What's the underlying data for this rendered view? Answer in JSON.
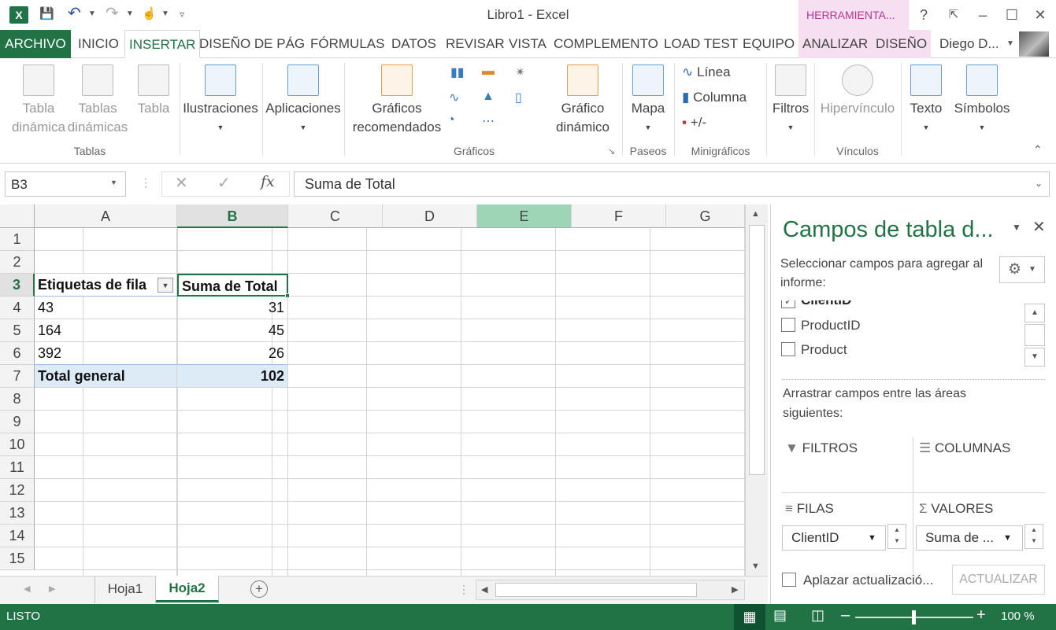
{
  "window": {
    "title": "Libro1 - Excel",
    "contextual_tab_group": "HERRAMIENTA...",
    "help": "?",
    "user": "Diego D..."
  },
  "tabs": [
    "ARCHIVO",
    "INICIO",
    "INSERTAR",
    "DISEÑO DE PÁG",
    "FÓRMULAS",
    "DATOS",
    "REVISAR",
    "VISTA",
    "COMPLEMENTO",
    "LOAD TEST",
    "EQUIPO",
    "ANALIZAR",
    "DISEÑO"
  ],
  "ribbon": {
    "tablas": {
      "btn1_l1": "Tabla",
      "btn1_l2": "dinámica",
      "btn2_l1": "Tablas",
      "btn2_l2": "dinámicas",
      "btn3": "Tabla",
      "label": "Tablas"
    },
    "ilustraciones": "Ilustraciones",
    "aplicaciones": "Aplicaciones",
    "graficos": {
      "rec_l1": "Gráficos",
      "rec_l2": "recomendados",
      "label": "Gráficos",
      "din_l1": "Gráfico",
      "din_l2": "dinámico"
    },
    "paseos": {
      "mapa": "Mapa",
      "label": "Paseos"
    },
    "minigraficos": {
      "linea": "Línea",
      "columna": "Columna",
      "ganancia": "+/-",
      "label": "Minigráficos"
    },
    "filtros": "Filtros",
    "vinculos": {
      "hipervinculo": "Hipervínculo",
      "label": "Vínculos"
    },
    "texto": "Texto",
    "simbolos": "Símbolos"
  },
  "formula_bar": {
    "name_box": "B3",
    "formula": "Suma de Total",
    "fx": "fx"
  },
  "grid": {
    "columns": [
      "A",
      "B",
      "C",
      "D",
      "E",
      "F",
      "G"
    ],
    "rows": [
      "1",
      "2",
      "3",
      "4",
      "5",
      "6",
      "7",
      "8",
      "9",
      "10",
      "11",
      "12",
      "13",
      "14",
      "15"
    ],
    "pivot": {
      "header_label": "Etiquetas de fila",
      "header_value": "Suma de Total",
      "items": [
        {
          "label": "43",
          "value": "31"
        },
        {
          "label": "164",
          "value": "45"
        },
        {
          "label": "392",
          "value": "26"
        }
      ],
      "total_label": "Total general",
      "total_value": "102"
    }
  },
  "sheets": [
    "Hoja1",
    "Hoja2"
  ],
  "status": {
    "ready": "LISTO",
    "zoom": "100 %"
  },
  "pane": {
    "title": "Campos de tabla d...",
    "instruction": "Seleccionar campos para agregar al informe:",
    "fields": [
      "ClientID",
      "ProductID",
      "Product"
    ],
    "drag_text": "Arrastrar campos entre las áreas siguientes:",
    "areas": {
      "filtros": "FILTROS",
      "columnas": "COLUMNAS",
      "filas": "FILAS",
      "valores": "VALORES"
    },
    "filas_item": "ClientID",
    "valores_item": "Suma de ...",
    "defer": "Aplazar actualizació...",
    "update": "ACTUALIZAR"
  },
  "colors": {
    "accent": "#217346",
    "contextual": "#f6dff0",
    "pivot_total": "#ddebf7"
  }
}
